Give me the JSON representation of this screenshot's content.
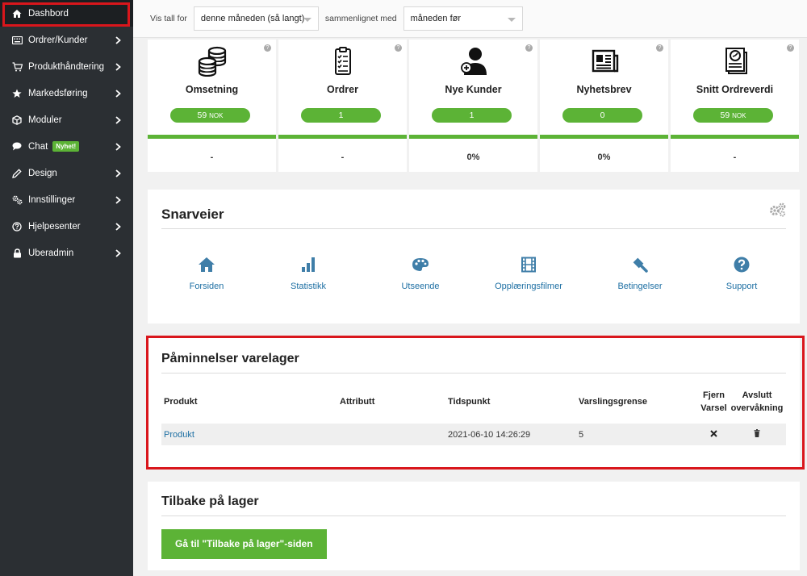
{
  "sidebar": {
    "items": [
      {
        "label": "Dashbord",
        "icon": "home-icon",
        "active": true,
        "chevron": false
      },
      {
        "label": "Ordrer/Kunder",
        "icon": "keyboard-icon",
        "active": false,
        "chevron": true
      },
      {
        "label": "Produkthåndtering",
        "icon": "cart-icon",
        "active": false,
        "chevron": true
      },
      {
        "label": "Markedsføring",
        "icon": "star-icon",
        "active": false,
        "chevron": true
      },
      {
        "label": "Moduler",
        "icon": "cube-icon",
        "active": false,
        "chevron": true
      },
      {
        "label": "Chat",
        "icon": "chat-icon",
        "active": false,
        "chevron": true,
        "badge": "Nyhet!"
      },
      {
        "label": "Design",
        "icon": "pencil-icon",
        "active": false,
        "chevron": true
      },
      {
        "label": "Innstillinger",
        "icon": "cogs-icon",
        "active": false,
        "chevron": true
      },
      {
        "label": "Hjelpesenter",
        "icon": "help-circle-icon",
        "active": false,
        "chevron": true
      },
      {
        "label": "Uberadmin",
        "icon": "lock-icon",
        "active": false,
        "chevron": true
      }
    ]
  },
  "filter": {
    "show_label": "Vis tall for",
    "period_value": "denne måneden (så langt)",
    "compare_label": "sammenlignet med",
    "compare_value": "måneden før"
  },
  "stats": [
    {
      "title": "Omsetning",
      "value": "59",
      "currency": "NOK",
      "change": "-",
      "icon": "coins-icon"
    },
    {
      "title": "Ordrer",
      "value": "1",
      "currency": "",
      "change": "-",
      "icon": "clipboard-icon"
    },
    {
      "title": "Nye Kunder",
      "value": "1",
      "currency": "",
      "change": "0%",
      "icon": "user-add-icon"
    },
    {
      "title": "Nyhetsbrev",
      "value": "0",
      "currency": "",
      "change": "0%",
      "icon": "newspaper-icon"
    },
    {
      "title": "Snitt Ordreverdi",
      "value": "59",
      "currency": "NOK",
      "change": "-",
      "icon": "report-icon"
    }
  ],
  "shortcuts": {
    "title": "Snarveier",
    "items": [
      {
        "label": "Forsiden",
        "icon": "home-icon"
      },
      {
        "label": "Statistikk",
        "icon": "bar-chart-icon"
      },
      {
        "label": "Utseende",
        "icon": "palette-icon"
      },
      {
        "label": "Opplæringsfilmer",
        "icon": "film-icon"
      },
      {
        "label": "Betingelser",
        "icon": "gavel-icon"
      },
      {
        "label": "Support",
        "icon": "question-icon"
      }
    ]
  },
  "stock_reminders": {
    "title": "Påminnelser varelager",
    "columns": {
      "product": "Produkt",
      "attribute": "Attributt",
      "timestamp": "Tidspunkt",
      "threshold": "Varslingsgrense",
      "remove_line1": "Fjern",
      "remove_line2": "Varsel",
      "end_line1": "Avslutt",
      "end_line2": "overvåkning"
    },
    "rows": [
      {
        "product": "Produkt",
        "attribute": "",
        "timestamp": "2021-06-10 14:26:29",
        "threshold": "5"
      }
    ]
  },
  "back_in_stock": {
    "title": "Tilbake på lager",
    "button": "Gå til \"Tilbake på lager\"-siden"
  },
  "colors": {
    "sidebar": "#2b2f33",
    "accent_green": "#5cb336",
    "highlight_red": "#d9161c",
    "link_blue": "#1d6fa3",
    "shortcut_icon": "#3f7ea8"
  }
}
